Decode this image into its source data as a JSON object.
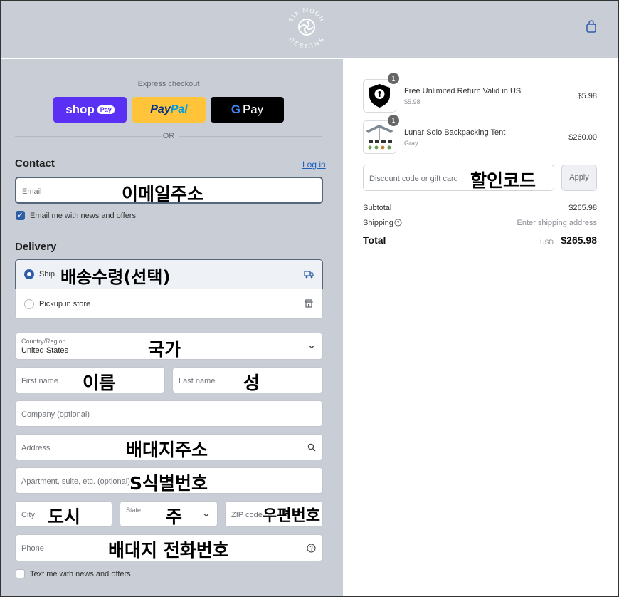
{
  "brand": {
    "logo_text_top": "SIX MOON",
    "logo_text_bottom": "DESIGNS"
  },
  "icons": {
    "bag": "shopping-bag-icon",
    "truck": "truck-icon",
    "store": "store-icon",
    "chevron": "chevron-down-icon",
    "search": "search-icon",
    "help": "help-circle-icon",
    "info": "info-icon"
  },
  "express": {
    "label": "Express checkout",
    "shop": "shop",
    "shop_pill": "Pay",
    "paypal_a": "Pay",
    "paypal_b": "Pal",
    "gpay_g": "G",
    "gpay": "Pay",
    "or": "OR"
  },
  "contact": {
    "title": "Contact",
    "login": "Log in",
    "email_placeholder": "Email",
    "email_note": "이메일주소",
    "newsletter": "Email me with news and offers"
  },
  "delivery": {
    "title": "Delivery",
    "ship": "Ship",
    "ship_note": "배송수령(선택)",
    "pickup": "Pickup in store",
    "country_label": "Country/Region",
    "country_value": "United States",
    "country_note": "국가",
    "first_name": "First name",
    "first_name_note": "이름",
    "last_name": "Last name",
    "last_name_note": "성",
    "company": "Company (optional)",
    "address": "Address",
    "address_note": "배대지주소",
    "apartment": "Apartment, suite, etc. (optional)",
    "apartment_note": "S식별번호",
    "city": "City",
    "city_note": "도시",
    "state": "State",
    "state_note": "주",
    "zip": "ZIP code",
    "zip_note": "우편번호",
    "phone": "Phone",
    "phone_note": "배대지 전화번호",
    "sms": "Text me with news and offers"
  },
  "cart": {
    "items": [
      {
        "qty": "1",
        "name": "Free Unlimited Return Valid in US.",
        "sub": "$5.98",
        "price": "$5.98"
      },
      {
        "qty": "1",
        "name": "Lunar Solo Backpacking Tent",
        "sub": "Gray",
        "price": "$260.00"
      }
    ],
    "discount_placeholder": "Discount code or gift card",
    "discount_note": "할인코드",
    "apply": "Apply",
    "subtotal_label": "Subtotal",
    "subtotal": "$265.98",
    "shipping_label": "Shipping",
    "shipping_value": "Enter shipping address",
    "total_label": "Total",
    "currency": "USD",
    "total": "$265.98"
  },
  "colors": {
    "shop": "#5a31f4",
    "paypal": "#ffc439",
    "gpay": "#000000",
    "accent": "#2f5da8",
    "panel": "#c9ced6"
  }
}
